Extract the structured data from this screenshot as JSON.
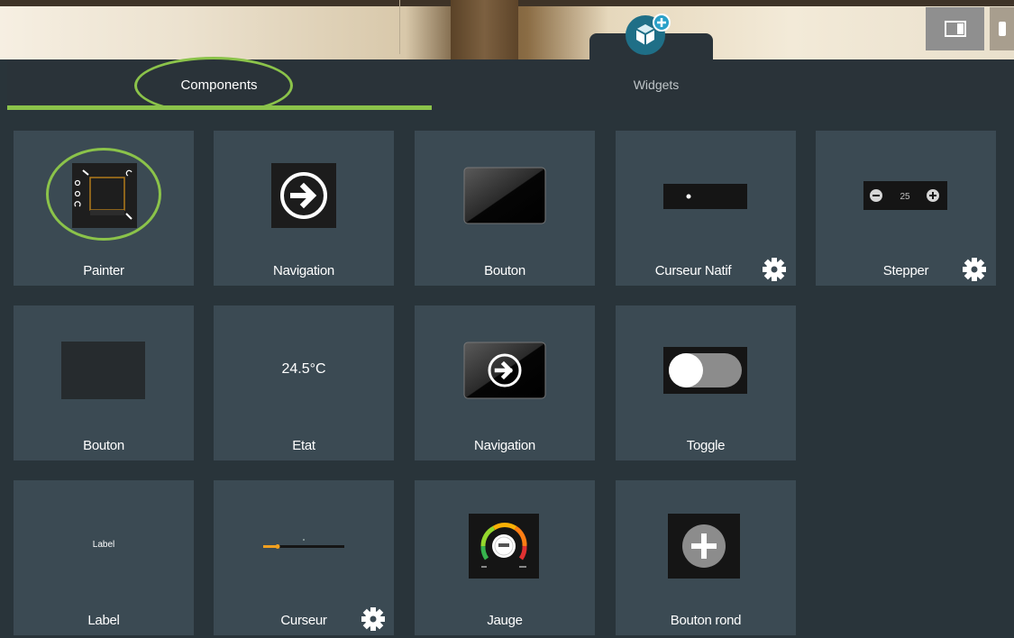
{
  "colors": {
    "accent": "#8bc34a",
    "tile_bg": "#3b4a53",
    "panel_bg": "#29343a",
    "logo_bg": "#1f6f87",
    "logo_badge": "#2aa0c8"
  },
  "header": {
    "logo_icon": "cube-add-icon",
    "view_icon": "panel-layout-icon",
    "device_icon": "phone-icon"
  },
  "tabs": [
    {
      "label": "Components",
      "active": true
    },
    {
      "label": "Widgets",
      "active": false
    }
  ],
  "tiles": [
    {
      "label": "Painter",
      "preview": "painter",
      "settings": false
    },
    {
      "label": "Navigation",
      "preview": "navigation-arrow",
      "settings": false
    },
    {
      "label": "Bouton",
      "preview": "glossy-button",
      "settings": false
    },
    {
      "label": "Curseur Natif",
      "preview": "native-slider",
      "settings": true
    },
    {
      "label": "Stepper",
      "preview": "stepper",
      "settings": true,
      "value": "25"
    },
    {
      "label": "Bouton",
      "preview": "flat-button",
      "settings": false
    },
    {
      "label": "Etat",
      "preview": "state-text",
      "settings": false,
      "value": "24.5°C"
    },
    {
      "label": "Navigation",
      "preview": "glossy-navigation",
      "settings": false
    },
    {
      "label": "Toggle",
      "preview": "toggle",
      "settings": false
    },
    {
      "label": "Label",
      "preview": "label-text",
      "settings": false,
      "value": "Label"
    },
    {
      "label": "Curseur",
      "preview": "slider",
      "settings": true
    },
    {
      "label": "Jauge",
      "preview": "gauge",
      "settings": false
    },
    {
      "label": "Bouton rond",
      "preview": "round-add-button",
      "settings": false
    }
  ]
}
